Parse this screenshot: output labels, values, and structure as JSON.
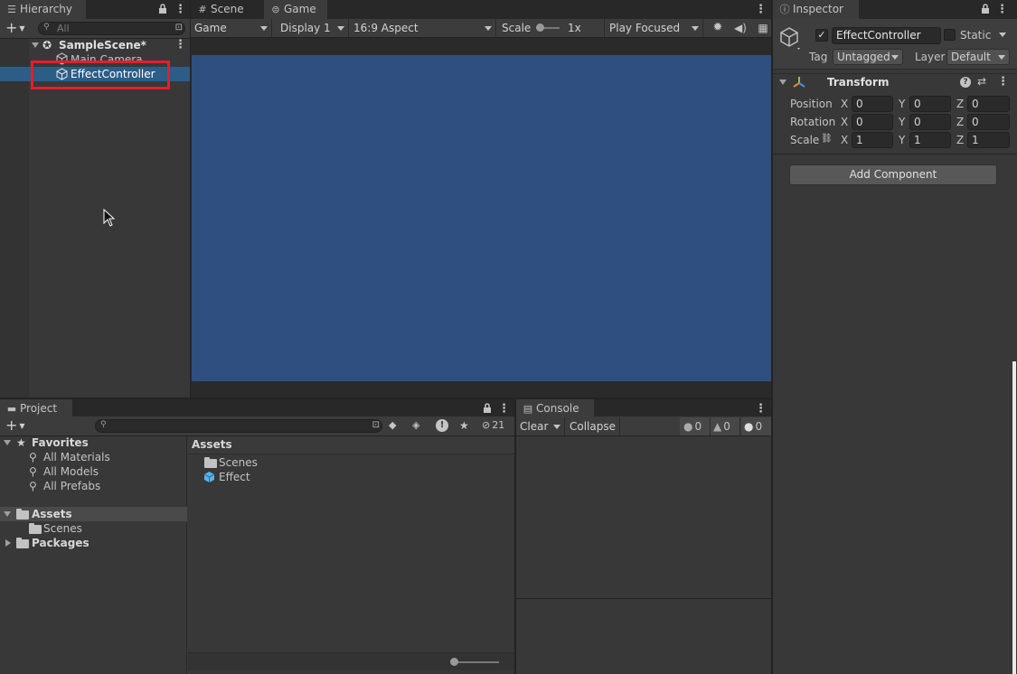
{
  "hierarchy": {
    "tab_label": "Hierarchy",
    "search_placeholder": "All",
    "scene_name": "SampleScene*",
    "items": [
      {
        "label": "Main Camera"
      },
      {
        "label": "EffectController"
      }
    ]
  },
  "scene_tab": {
    "label": "Scene"
  },
  "game": {
    "tab_label": "Game",
    "mode": "Game",
    "display": "Display 1",
    "aspect": "16:9 Aspect",
    "scale_label": "Scale",
    "scale_value": "1x",
    "play_mode": "Play Focused",
    "viewport_color": "#2f4f80"
  },
  "inspector": {
    "tab_label": "Inspector",
    "object_name": "EffectController",
    "static_label": "Static",
    "tag_label": "Tag",
    "tag_value": "Untagged",
    "layer_label": "Layer",
    "layer_value": "Default",
    "transform_label": "Transform",
    "rows": [
      {
        "label": "Position",
        "x": "0",
        "y": "0",
        "z": "0"
      },
      {
        "label": "Rotation",
        "x": "0",
        "y": "0",
        "z": "0"
      },
      {
        "label": "Scale",
        "x": "1",
        "y": "1",
        "z": "1"
      }
    ],
    "axis_x": "X",
    "axis_y": "Y",
    "axis_z": "Z",
    "add_component": "Add Component"
  },
  "project": {
    "tab_label": "Project",
    "hidden_count": "21",
    "favorites_label": "Favorites",
    "favorites": [
      "All Materials",
      "All Models",
      "All Prefabs"
    ],
    "assets_label": "Assets",
    "assets_children": [
      "Scenes"
    ],
    "packages_label": "Packages",
    "assets_header": "Assets",
    "asset_items": [
      "Scenes",
      "Effect"
    ]
  },
  "console": {
    "tab_label": "Console",
    "clear_label": "Clear",
    "collapse_label": "Collapse",
    "info_count": "0",
    "warn_count": "0",
    "error_count": "0"
  },
  "colors": {
    "selection": "#2c5d87",
    "highlight_box": "#e0202a",
    "viewport": "#2f4f80"
  }
}
